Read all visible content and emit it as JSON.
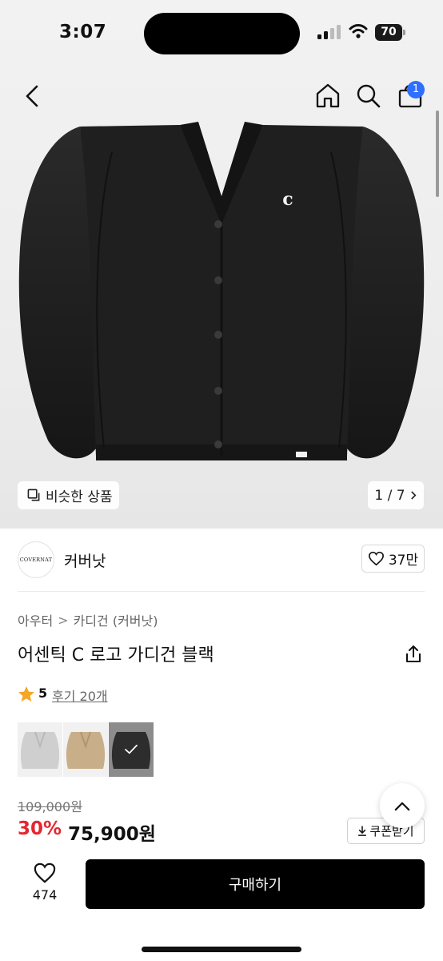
{
  "status_bar": {
    "time": "3:07",
    "battery": "70"
  },
  "nav": {
    "cart_count": "1",
    "icons": [
      "chevron-left-icon",
      "home-icon",
      "search-icon",
      "cart-icon"
    ]
  },
  "gallery": {
    "similar_label": "비슷한 상품",
    "pager": "1 / 7"
  },
  "brand": {
    "logo_text": "COVERNAT",
    "name": "커버낫",
    "likes": "37만"
  },
  "breadcrumb": {
    "level1": "아우터",
    "level2": "카디건 (커버낫)"
  },
  "product": {
    "title": "어센틱 C 로고 가디건 블랙",
    "rating": "5",
    "reviews": "후기 20개",
    "colors": [
      "#d8d8d8",
      "#cdb594",
      "#1c1c1c"
    ],
    "selected_color_index": 2
  },
  "price": {
    "original": "109,000원",
    "discount": "30%",
    "sale": "75,900원",
    "coupon_label": "쿠폰받기"
  },
  "bottom": {
    "wish_count": "474",
    "buy_label": "구매하기"
  },
  "theme": {
    "accent_red": "#e4262f",
    "badge_blue": "#2f6fff",
    "buy_button": "#000000"
  }
}
